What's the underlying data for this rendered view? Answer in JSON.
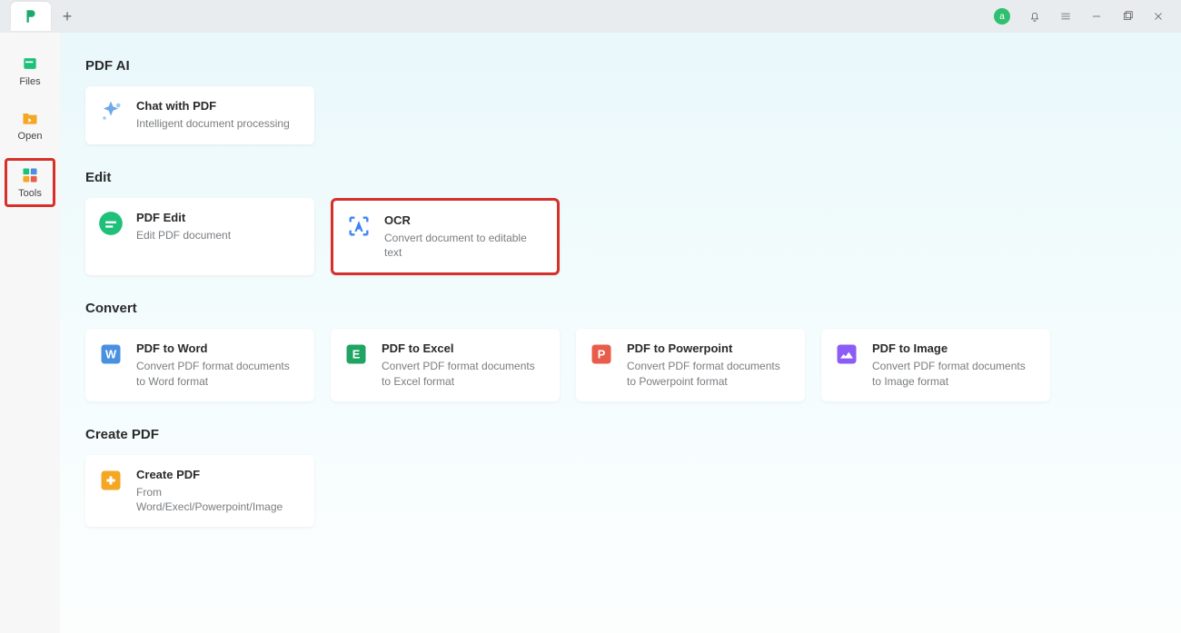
{
  "titlebar": {
    "user_initial": "a"
  },
  "sidebar": {
    "files": "Files",
    "open": "Open",
    "tools": "Tools"
  },
  "sections": {
    "pdf_ai": {
      "title": "PDF AI",
      "chat": {
        "title": "Chat with PDF",
        "desc": "Intelligent document processing"
      }
    },
    "edit": {
      "title": "Edit",
      "pdf_edit": {
        "title": "PDF Edit",
        "desc": "Edit PDF document"
      },
      "ocr": {
        "title": "OCR",
        "desc": "Convert document to editable text"
      }
    },
    "convert": {
      "title": "Convert",
      "word": {
        "title": "PDF to Word",
        "desc": "Convert PDF format documents to Word format"
      },
      "excel": {
        "title": "PDF to Excel",
        "desc": "Convert PDF format documents to Excel format"
      },
      "ppt": {
        "title": "PDF to Powerpoint",
        "desc": "Convert PDF format documents to Powerpoint format"
      },
      "image": {
        "title": "PDF to Image",
        "desc": "Convert PDF format documents to Image format"
      }
    },
    "create": {
      "title": "Create PDF",
      "create": {
        "title": "Create PDF",
        "desc": "From Word/Execl/Powerpoint/Image"
      }
    }
  }
}
